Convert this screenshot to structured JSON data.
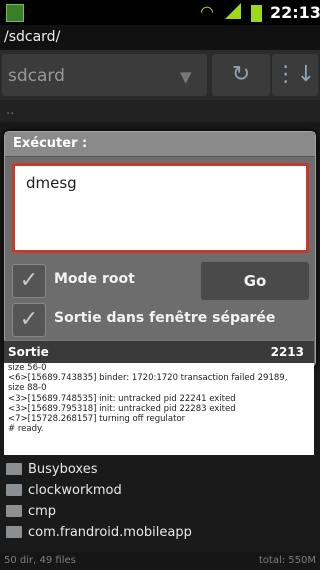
{
  "status_bar": {
    "time": "22:13",
    "icons": [
      "app-icon",
      "wifi-icon",
      "signal-icon",
      "battery-icon"
    ]
  },
  "path": "/sdcard/",
  "toolbar": {
    "spinner_value": "sdcard",
    "buttons": [
      "refresh-icon",
      "sort-icon"
    ]
  },
  "up_row": "..",
  "dialog": {
    "title": "Exécuter :",
    "command": "dmesg",
    "mode_root_label": "Mode root",
    "go_label": "Go",
    "separate_window_label": "Sortie dans fenêtre séparée"
  },
  "output": {
    "header": "Sortie",
    "count": "2213",
    "lines": [
      "size 56-0",
      "<6>[15689.743835] binder: 1720:1720 transaction failed 29189,",
      "size 88-0",
      "<3>[15689.748535] init: untracked pid 22241 exited",
      "<3>[15689.795318] init: untracked pid 22283 exited",
      "<7>[15728.268157] turning off regulator",
      "# ready."
    ]
  },
  "files": [
    {
      "name": "Busyboxes"
    },
    {
      "name": "clockworkmod"
    },
    {
      "name": "cmp"
    },
    {
      "name": "com.frandroid.mobileapp"
    }
  ],
  "footer": {
    "left": "50 dir, 49 files",
    "right": "total: 550M"
  },
  "colors": {
    "input_border": "#c43b2a",
    "status_accent": "#9dd81a"
  }
}
